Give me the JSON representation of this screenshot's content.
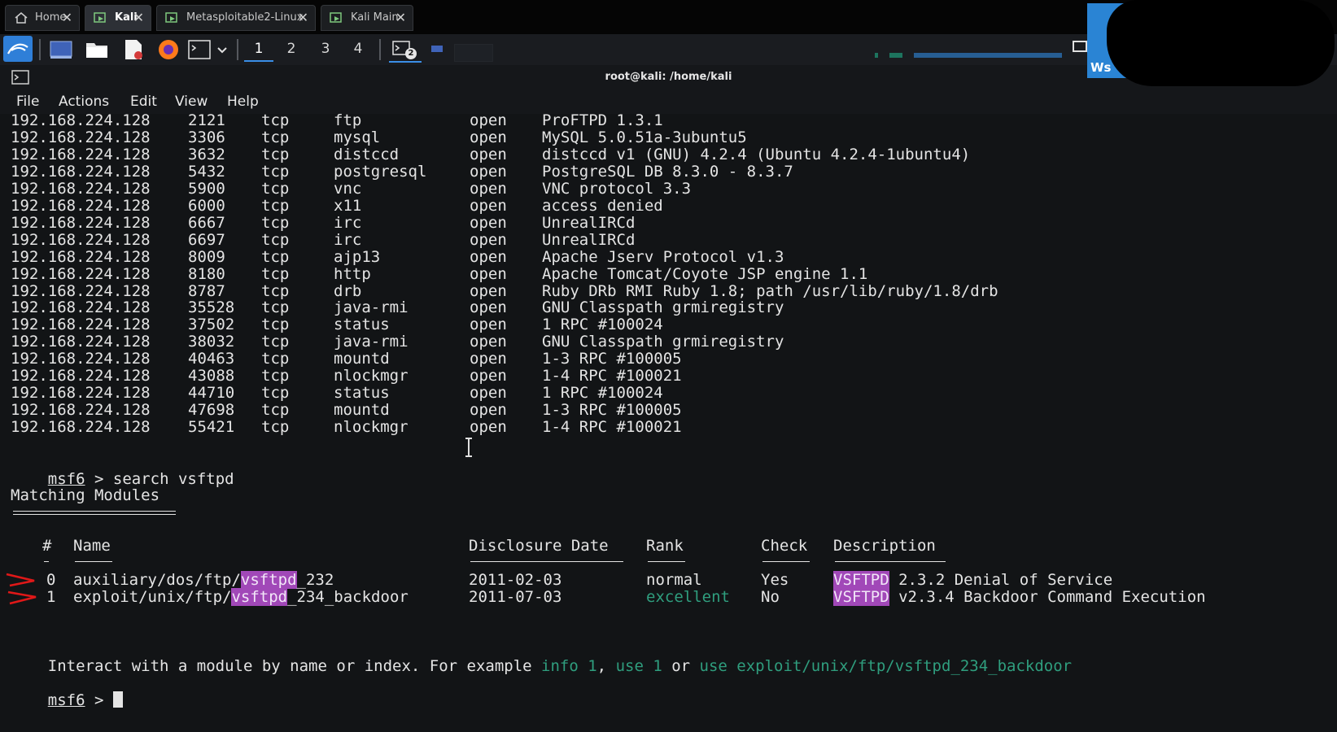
{
  "tabs": [
    {
      "label": "Home",
      "active": false,
      "icon": "home-icon"
    },
    {
      "label": "Kali",
      "active": true,
      "icon": "vm-icon"
    },
    {
      "label": "Metasploitable2-Linux",
      "active": false,
      "icon": "vm-icon"
    },
    {
      "label": "Kali Main",
      "active": false,
      "icon": "vm-icon"
    }
  ],
  "tab_close_glyph": "✕",
  "panel": {
    "workspaces": [
      "1",
      "2",
      "3",
      "4"
    ],
    "active_workspace": "1",
    "badge": "2",
    "overlay_text": "Ws"
  },
  "window": {
    "title": "root@kali: /home/kali",
    "menu": [
      "File",
      "Actions",
      "Edit",
      "View",
      "Help"
    ]
  },
  "services": [
    [
      "192.168.224.128",
      "2121",
      "tcp",
      "ftp",
      "open",
      "ProFTPD 1.3.1"
    ],
    [
      "192.168.224.128",
      "3306",
      "tcp",
      "mysql",
      "open",
      "MySQL 5.0.51a-3ubuntu5"
    ],
    [
      "192.168.224.128",
      "3632",
      "tcp",
      "distccd",
      "open",
      "distccd v1 (GNU) 4.2.4 (Ubuntu 4.2.4-1ubuntu4)"
    ],
    [
      "192.168.224.128",
      "5432",
      "tcp",
      "postgresql",
      "open",
      "PostgreSQL DB 8.3.0 - 8.3.7"
    ],
    [
      "192.168.224.128",
      "5900",
      "tcp",
      "vnc",
      "open",
      "VNC protocol 3.3"
    ],
    [
      "192.168.224.128",
      "6000",
      "tcp",
      "x11",
      "open",
      "access denied"
    ],
    [
      "192.168.224.128",
      "6667",
      "tcp",
      "irc",
      "open",
      "UnrealIRCd"
    ],
    [
      "192.168.224.128",
      "6697",
      "tcp",
      "irc",
      "open",
      "UnrealIRCd"
    ],
    [
      "192.168.224.128",
      "8009",
      "tcp",
      "ajp13",
      "open",
      "Apache Jserv Protocol v1.3"
    ],
    [
      "192.168.224.128",
      "8180",
      "tcp",
      "http",
      "open",
      "Apache Tomcat/Coyote JSP engine 1.1"
    ],
    [
      "192.168.224.128",
      "8787",
      "tcp",
      "drb",
      "open",
      "Ruby DRb RMI Ruby 1.8; path /usr/lib/ruby/1.8/drb"
    ],
    [
      "192.168.224.128",
      "35528",
      "tcp",
      "java-rmi",
      "open",
      "GNU Classpath grmiregistry"
    ],
    [
      "192.168.224.128",
      "37502",
      "tcp",
      "status",
      "open",
      "1 RPC #100024"
    ],
    [
      "192.168.224.128",
      "38032",
      "tcp",
      "java-rmi",
      "open",
      "GNU Classpath grmiregistry"
    ],
    [
      "192.168.224.128",
      "40463",
      "tcp",
      "mountd",
      "open",
      "1-3 RPC #100005"
    ],
    [
      "192.168.224.128",
      "43088",
      "tcp",
      "nlockmgr",
      "open",
      "1-4 RPC #100021"
    ],
    [
      "192.168.224.128",
      "44710",
      "tcp",
      "status",
      "open",
      "1 RPC #100024"
    ],
    [
      "192.168.224.128",
      "47698",
      "tcp",
      "mountd",
      "open",
      "1-3 RPC #100005"
    ],
    [
      "192.168.224.128",
      "55421",
      "tcp",
      "nlockmgr",
      "open",
      "1-4 RPC #100021"
    ]
  ],
  "command": {
    "prompt": "msf6",
    "arrow": ">",
    "text": "search vsftpd"
  },
  "matching_title": "Matching Modules",
  "module_headers": {
    "num": "#",
    "name": "Name",
    "date": "Disclosure Date",
    "rank": "Rank",
    "check": "Check",
    "description": "Description"
  },
  "modules": [
    {
      "num": "0",
      "name_pre": "auxiliary/dos/ftp/",
      "name_hl": "vsftpd",
      "name_post": "_232",
      "date": "2011-02-03",
      "rank": "normal",
      "check": "Yes",
      "desc_hl": "VSFTPD",
      "desc_rest": " 2.3.2 Denial of Service"
    },
    {
      "num": "1",
      "name_pre": "exploit/unix/ftp/",
      "name_hl": "vsftpd",
      "name_post": "_234_backdoor",
      "date": "2011-07-03",
      "rank": "excellent",
      "check": "No",
      "desc_hl": "VSFTPD",
      "desc_rest": " v2.3.4 Backdoor Command Execution"
    }
  ],
  "interact": {
    "prefix": "Interact with a module by name or index. For example ",
    "info": "info 1",
    "sep1": ", ",
    "use": "use 1",
    "sep2": " or ",
    "use_full": "use exploit/unix/ftp/vsftpd_234_backdoor"
  },
  "final_prompt": {
    "prompt": "msf6",
    "arrow": ">"
  },
  "colors": {
    "highlight": "#a148b8",
    "link_green": "#2f9e7e",
    "annotation_red": "#e01818",
    "accent_blue": "#3a8ee6"
  }
}
